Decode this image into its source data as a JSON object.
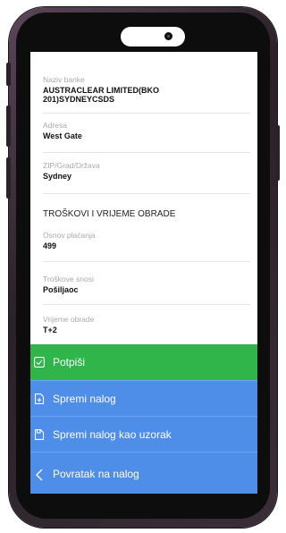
{
  "details": {
    "bank_name_label": "Naziv banke",
    "bank_name_value_line1": "AUSTRACLEAR LIMITED(BKO",
    "bank_name_value_line2": "201)SYDNEYCSDS",
    "address_label": "Adresa",
    "address_value": "West Gate",
    "zip_label": "ZIP/Grad/Država",
    "zip_value": "Sydney"
  },
  "costs": {
    "section_title": "TROŠKOVI I VRIJEME OBRADE",
    "payment_basis_label": "Osnov plaćanja",
    "payment_basis_value": "499",
    "costs_borne_label": "Troškove snosi",
    "costs_borne_value": "Pošiljaoc",
    "processing_time_label": "Vrijeme obrade",
    "processing_time_value": "T+2"
  },
  "actions": {
    "sign": "Potpiši",
    "save_order": "Spremi nalog",
    "save_template": "Spremi nalog kao uzorak",
    "back": "Povratak na nalog"
  },
  "colors": {
    "sign_bg": "#2fb54a",
    "action_bg": "#4e8de8"
  }
}
